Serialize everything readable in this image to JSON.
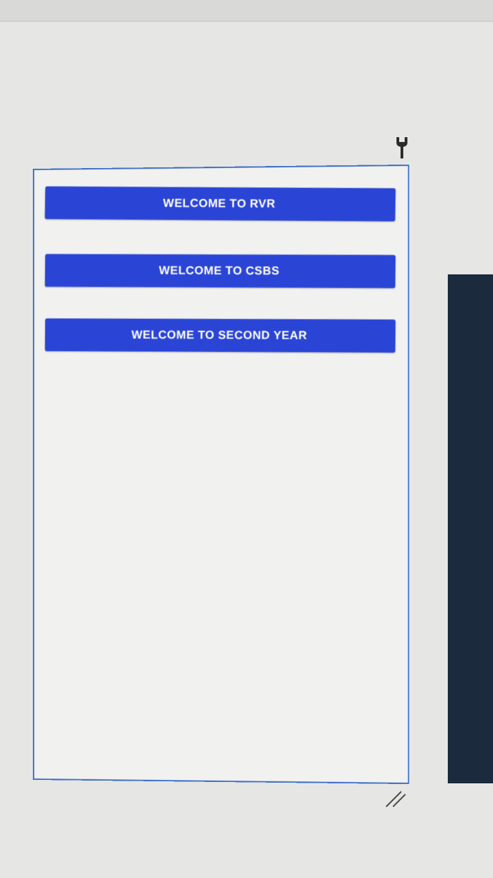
{
  "icons": {
    "wrench": "wrench-icon",
    "resize": "resize-handle-icon"
  },
  "app": {
    "buttons": [
      {
        "label": "WELCOME TO RVR"
      },
      {
        "label": "WELCOME TO CSBS"
      },
      {
        "label": "WELCOME TO SECOND YEAR"
      }
    ]
  },
  "colors": {
    "button_bg": "#2a45d6",
    "button_text": "#ffffff",
    "frame_border": "#3c6fc8",
    "screen_bg": "#f1f1ef"
  }
}
